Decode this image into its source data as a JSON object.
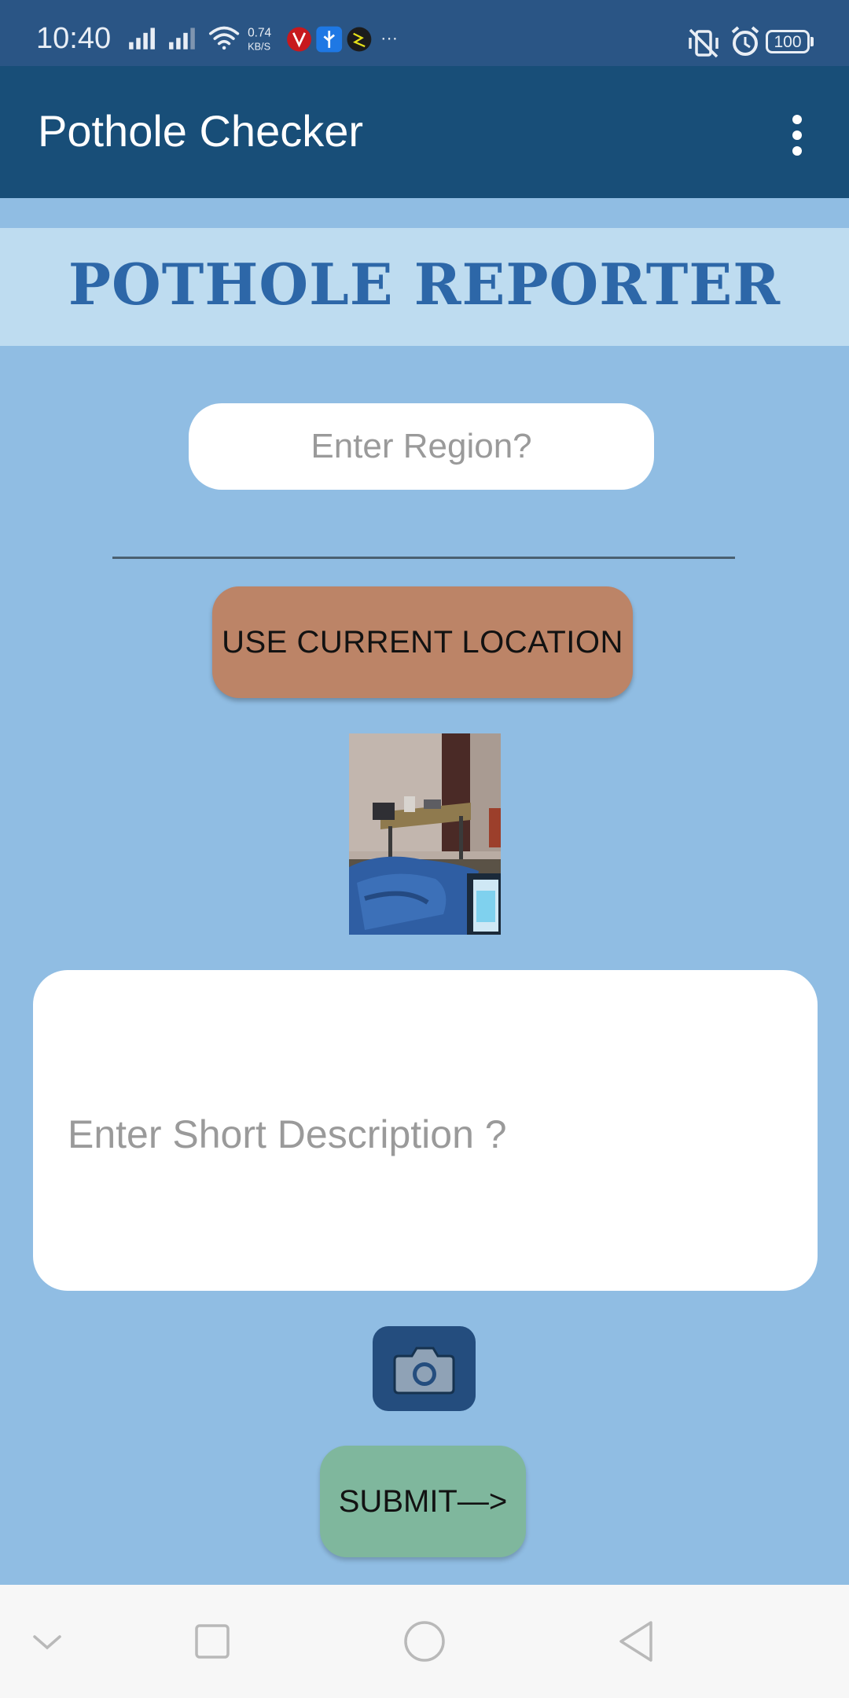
{
  "status_bar": {
    "time": "10:40",
    "network_speed_value": "0.74",
    "network_speed_unit": "KB/S",
    "more_indicator": "···",
    "battery": "100",
    "icons": [
      "signal-icon",
      "signal-icon",
      "wifi-icon",
      "app-notification-icon",
      "usb-icon",
      "app-notification-icon",
      "vibrate-icon",
      "alarm-icon",
      "battery-icon"
    ]
  },
  "app_bar": {
    "title": "Pothole Checker",
    "menu_icon": "overflow-menu-icon"
  },
  "banner": {
    "title": "POTHOLE REPORTER"
  },
  "form": {
    "region_placeholder": "Enter Region?",
    "region_value": "",
    "location_button_label": "USE CURRENT LOCATION",
    "description_placeholder": "Enter Short Description ?",
    "description_value": "",
    "camera_icon": "camera-icon",
    "submit_label": "SUBMIT—>"
  },
  "nav_bar": {
    "icons": [
      "chevron-down-icon",
      "recents-icon",
      "home-icon",
      "back-icon"
    ]
  },
  "colors": {
    "status_bar": "#2a5585",
    "app_bar": "#184e78",
    "background": "#90bde3",
    "banner": "#bedcf0",
    "banner_text": "#2d67a8",
    "location_button": "#bc8467",
    "camera_button": "#244d7e",
    "submit_button": "#7fb79d"
  }
}
